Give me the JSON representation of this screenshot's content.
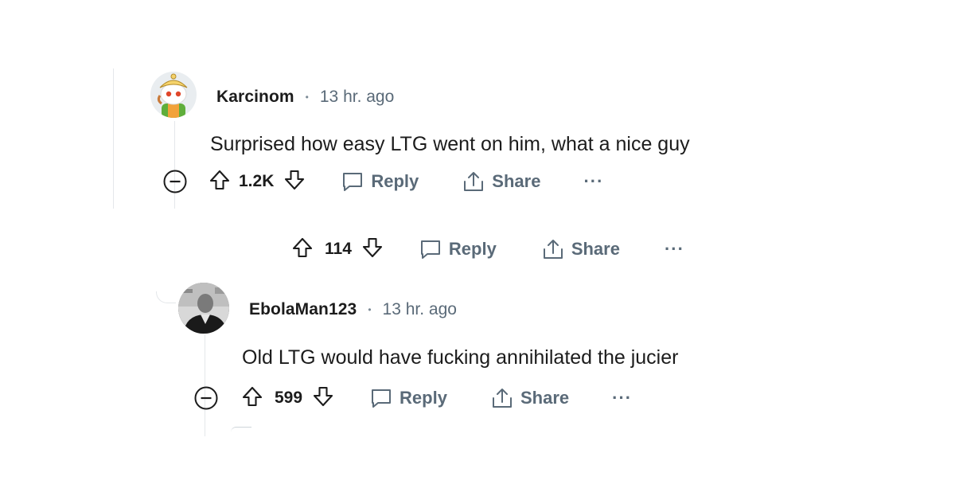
{
  "comments": [
    {
      "username": "Karcinom",
      "separator": "•",
      "time": "13 hr. ago",
      "text": "Surprised how easy LTG went on him, what a nice guy",
      "score": "1.2K",
      "reply_label": "Reply",
      "share_label": "Share",
      "more_label": "···",
      "avatar_icon": "snoo-avatar-icon"
    },
    {
      "username": "EbolaMan123",
      "separator": "•",
      "time": "13 hr. ago",
      "text": "Old LTG would have fucking annihilated the jucier",
      "score": "599",
      "reply_label": "Reply",
      "share_label": "Share",
      "more_label": "···",
      "avatar_icon": "photo-avatar-icon"
    }
  ],
  "parent_actions": {
    "score": "114",
    "reply_label": "Reply",
    "share_label": "Share",
    "more_label": "···"
  }
}
